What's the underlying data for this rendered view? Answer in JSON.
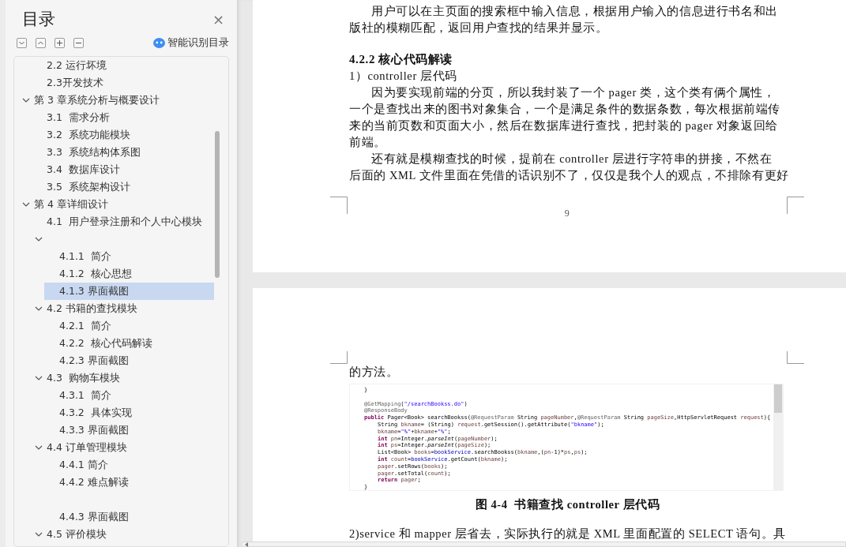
{
  "outline": {
    "title": "目录",
    "close": "×",
    "smart_toc": "智能识别目录",
    "items": [
      {
        "children": [
          {
            "label": "2.2 运行坏境",
            "selected": false
          },
          {
            "label": "2.3开发技术",
            "selected": false
          }
        ]
      },
      {
        "label": "第 3 章系统分析与概要设计",
        "selected": false,
        "expanded": true,
        "children": [
          {
            "label": "3.1  需求分析",
            "selected": false
          },
          {
            "label": "3.2  系统功能模块",
            "selected": false
          },
          {
            "label": "3.3  系统结构体系图",
            "selected": false
          },
          {
            "label": "3.4  数据库设计",
            "selected": false
          },
          {
            "label": "3.5  系统架构设计",
            "selected": false
          }
        ]
      },
      {
        "label": "第 4 章详细设计",
        "selected": false,
        "expanded": true,
        "children": [
          {
            "label": "4.1  用户登录注册和个人中心模块",
            "selected": false
          },
          {
            "selected": false,
            "expanded": true,
            "children": [
              {
                "label": "4.1.1  简介",
                "selected": false
              },
              {
                "label": "4.1.2  核心思想",
                "selected": false
              },
              {
                "label": "4.1.3 界面截图",
                "selected": true
              }
            ]
          },
          {
            "label": "4.2 书籍的查找模块",
            "selected": false,
            "expanded": true,
            "children": [
              {
                "label": "4.2.1  简介",
                "selected": false
              },
              {
                "label": "4.2.2  核心代码解读",
                "selected": false
              },
              {
                "label": "4.2.3 界面截图",
                "selected": false
              }
            ]
          },
          {
            "label": "4.3  购物车模块",
            "selected": false,
            "expanded": true,
            "children": [
              {
                "label": "4.3.1  简介",
                "selected": false
              },
              {
                "label": "4.3.2  具体实现",
                "selected": false
              },
              {
                "label": "4.3.3 界面截图",
                "selected": false
              }
            ]
          },
          {
            "label": "4.4 订单管理模块",
            "selected": false,
            "expanded": true,
            "children": [
              {
                "kind": "entry",
                "label": "4.4.1 简介",
                "selected": false
              },
              {
                "kind": "entry",
                "label": "4.4.2 难点解读",
                "selected": false
              },
              {
                "kind": "blank"
              },
              {
                "kind": "entry",
                "label": "4.4.3 界面截图",
                "selected": false
              }
            ]
          },
          {
            "label": "4.5 评价模块",
            "selected": false,
            "expanded": true
          }
        ]
      }
    ]
  },
  "page1": {
    "blocks": [
      {
        "kind": "paragraph",
        "lines": [
          "用户可以在主页面的搜索框中输入信息，根据用户输入的信息进行书名和出",
          "版社的模糊匹配，返回用户查找的结果并显示。"
        ]
      },
      {
        "kind": "heading",
        "text": "4.2.2 核心代码解读"
      },
      {
        "kind": "line",
        "text": "1）controller 层代码"
      },
      {
        "kind": "paragraph",
        "lines": [
          "因为要实现前端的分页，所以我封装了一个 pager 类，这个类有俩个属性，",
          "一个是查找出来的图书对象集合，一个是满足条件的数据条数，每次根据前端传",
          "来的当前页数和页面大小，然后在数据库进行查找，把封装的 pager 对象返回给",
          "前端。"
        ]
      },
      {
        "kind": "paragraph",
        "lines": [
          "还有就是模糊查找的时候，提前在 controller 层进行字符串的拼接，不然在",
          "后面的 XML 文件里面在凭借的话识别不了，仅仅是我个人的观点，不排除有更好"
        ]
      }
    ],
    "page_number": "9"
  },
  "page2": {
    "continuation": "的方法。",
    "code": [
      {
        "kind": "code",
        "segments": [
          {
            "kind": "plain",
            "text": "}"
          }
        ]
      },
      {
        "kind": "blank"
      },
      {
        "kind": "code",
        "segments": [
          {
            "kind": "annotation",
            "text": "@GetMapping"
          },
          {
            "kind": "plain",
            "text": "("
          },
          {
            "kind": "string",
            "text": "\"/searchBookss.do\""
          },
          {
            "kind": "plain",
            "text": ")"
          }
        ]
      },
      {
        "kind": "code",
        "segments": [
          {
            "kind": "annotation",
            "text": "@ResponseBody"
          }
        ]
      },
      {
        "kind": "code",
        "segments": [
          {
            "kind": "keyword",
            "text": "public"
          },
          {
            "kind": "plain",
            "text": " Pager<Book> searchBookss("
          },
          {
            "kind": "annotation",
            "text": "@RequestParam"
          },
          {
            "kind": "plain",
            "text": " String "
          },
          {
            "kind": "local",
            "text": "pageNumber"
          },
          {
            "kind": "plain",
            "text": ","
          },
          {
            "kind": "annotation",
            "text": "@RequestParam"
          },
          {
            "kind": "plain",
            "text": " String "
          },
          {
            "kind": "local",
            "text": "pageSize"
          },
          {
            "kind": "plain",
            "text": ",HttpServletRequest "
          },
          {
            "kind": "local",
            "text": "request"
          },
          {
            "kind": "plain",
            "text": "){"
          }
        ]
      },
      {
        "kind": "code",
        "indent": true,
        "segments": [
          {
            "kind": "plain",
            "text": "String "
          },
          {
            "kind": "local",
            "text": "bkname"
          },
          {
            "kind": "plain",
            "text": "= (String) "
          },
          {
            "kind": "local",
            "text": "request"
          },
          {
            "kind": "plain",
            "text": ".getSession().getAttribute("
          },
          {
            "kind": "string",
            "text": "\"bkname\""
          },
          {
            "kind": "plain",
            "text": ");"
          }
        ]
      },
      {
        "kind": "code",
        "indent": true,
        "segments": [
          {
            "kind": "local",
            "text": "bkname"
          },
          {
            "kind": "plain",
            "text": "="
          },
          {
            "kind": "string",
            "text": "\"%\""
          },
          {
            "kind": "plain",
            "text": "+"
          },
          {
            "kind": "local",
            "text": "bkname"
          },
          {
            "kind": "plain",
            "text": "+"
          },
          {
            "kind": "string",
            "text": "\"%\""
          },
          {
            "kind": "plain",
            "text": ";"
          }
        ]
      },
      {
        "kind": "code",
        "indent": true,
        "segments": [
          {
            "kind": "keyword",
            "text": "int"
          },
          {
            "kind": "local",
            "text": " pn"
          },
          {
            "kind": "plain",
            "text": "=Integer."
          },
          {
            "kind": "static",
            "text": "parseInt"
          },
          {
            "kind": "plain",
            "text": "("
          },
          {
            "kind": "local",
            "text": "pageNumber"
          },
          {
            "kind": "plain",
            "text": ");"
          }
        ]
      },
      {
        "kind": "code",
        "indent": true,
        "segments": [
          {
            "kind": "keyword",
            "text": "int"
          },
          {
            "kind": "local",
            "text": " ps"
          },
          {
            "kind": "plain",
            "text": "=Integer."
          },
          {
            "kind": "static",
            "text": "parseInt"
          },
          {
            "kind": "plain",
            "text": "("
          },
          {
            "kind": "local",
            "text": "pageSize"
          },
          {
            "kind": "plain",
            "text": ");"
          }
        ]
      },
      {
        "kind": "code",
        "indent": true,
        "segments": [
          {
            "kind": "plain",
            "text": "List<Book> "
          },
          {
            "kind": "local",
            "text": "books"
          },
          {
            "kind": "plain",
            "text": "="
          },
          {
            "kind": "field",
            "text": "bookService"
          },
          {
            "kind": "plain",
            "text": ".searchBookss("
          },
          {
            "kind": "local",
            "text": "bkname"
          },
          {
            "kind": "plain",
            "text": ",("
          },
          {
            "kind": "local",
            "text": "pn"
          },
          {
            "kind": "plain",
            "text": "-1)*"
          },
          {
            "kind": "local",
            "text": "ps"
          },
          {
            "kind": "plain",
            "text": ","
          },
          {
            "kind": "local",
            "text": "ps"
          },
          {
            "kind": "plain",
            "text": ");"
          }
        ]
      },
      {
        "kind": "code",
        "indent": true,
        "segments": [
          {
            "kind": "keyword",
            "text": "int"
          },
          {
            "kind": "local",
            "text": " count"
          },
          {
            "kind": "plain",
            "text": "="
          },
          {
            "kind": "field",
            "text": "bookService"
          },
          {
            "kind": "plain",
            "text": ".getCount("
          },
          {
            "kind": "local",
            "text": "bkname"
          },
          {
            "kind": "plain",
            "text": ");"
          }
        ]
      },
      {
        "kind": "code",
        "indent": true,
        "segments": [
          {
            "kind": "local",
            "text": "pager"
          },
          {
            "kind": "plain",
            "text": ".setRows("
          },
          {
            "kind": "local",
            "text": "books"
          },
          {
            "kind": "plain",
            "text": ");"
          }
        ]
      },
      {
        "kind": "code",
        "indent": true,
        "segments": [
          {
            "kind": "local",
            "text": "pager"
          },
          {
            "kind": "plain",
            "text": ".setTotal("
          },
          {
            "kind": "local",
            "text": "count"
          },
          {
            "kind": "plain",
            "text": ");"
          }
        ]
      },
      {
        "kind": "code",
        "indent": true,
        "segments": [
          {
            "kind": "keyword",
            "text": "return"
          },
          {
            "kind": "local",
            "text": " pager"
          },
          {
            "kind": "plain",
            "text": ";"
          }
        ]
      },
      {
        "kind": "code",
        "segments": [
          {
            "kind": "plain",
            "text": "}"
          }
        ]
      }
    ],
    "caption": "图 4-4  书籍查找 controller 层代码",
    "last_line": "2)service 和 mapper 层省去，实际执行的就是 XML 里面配置的 SELECT 语句。具"
  }
}
